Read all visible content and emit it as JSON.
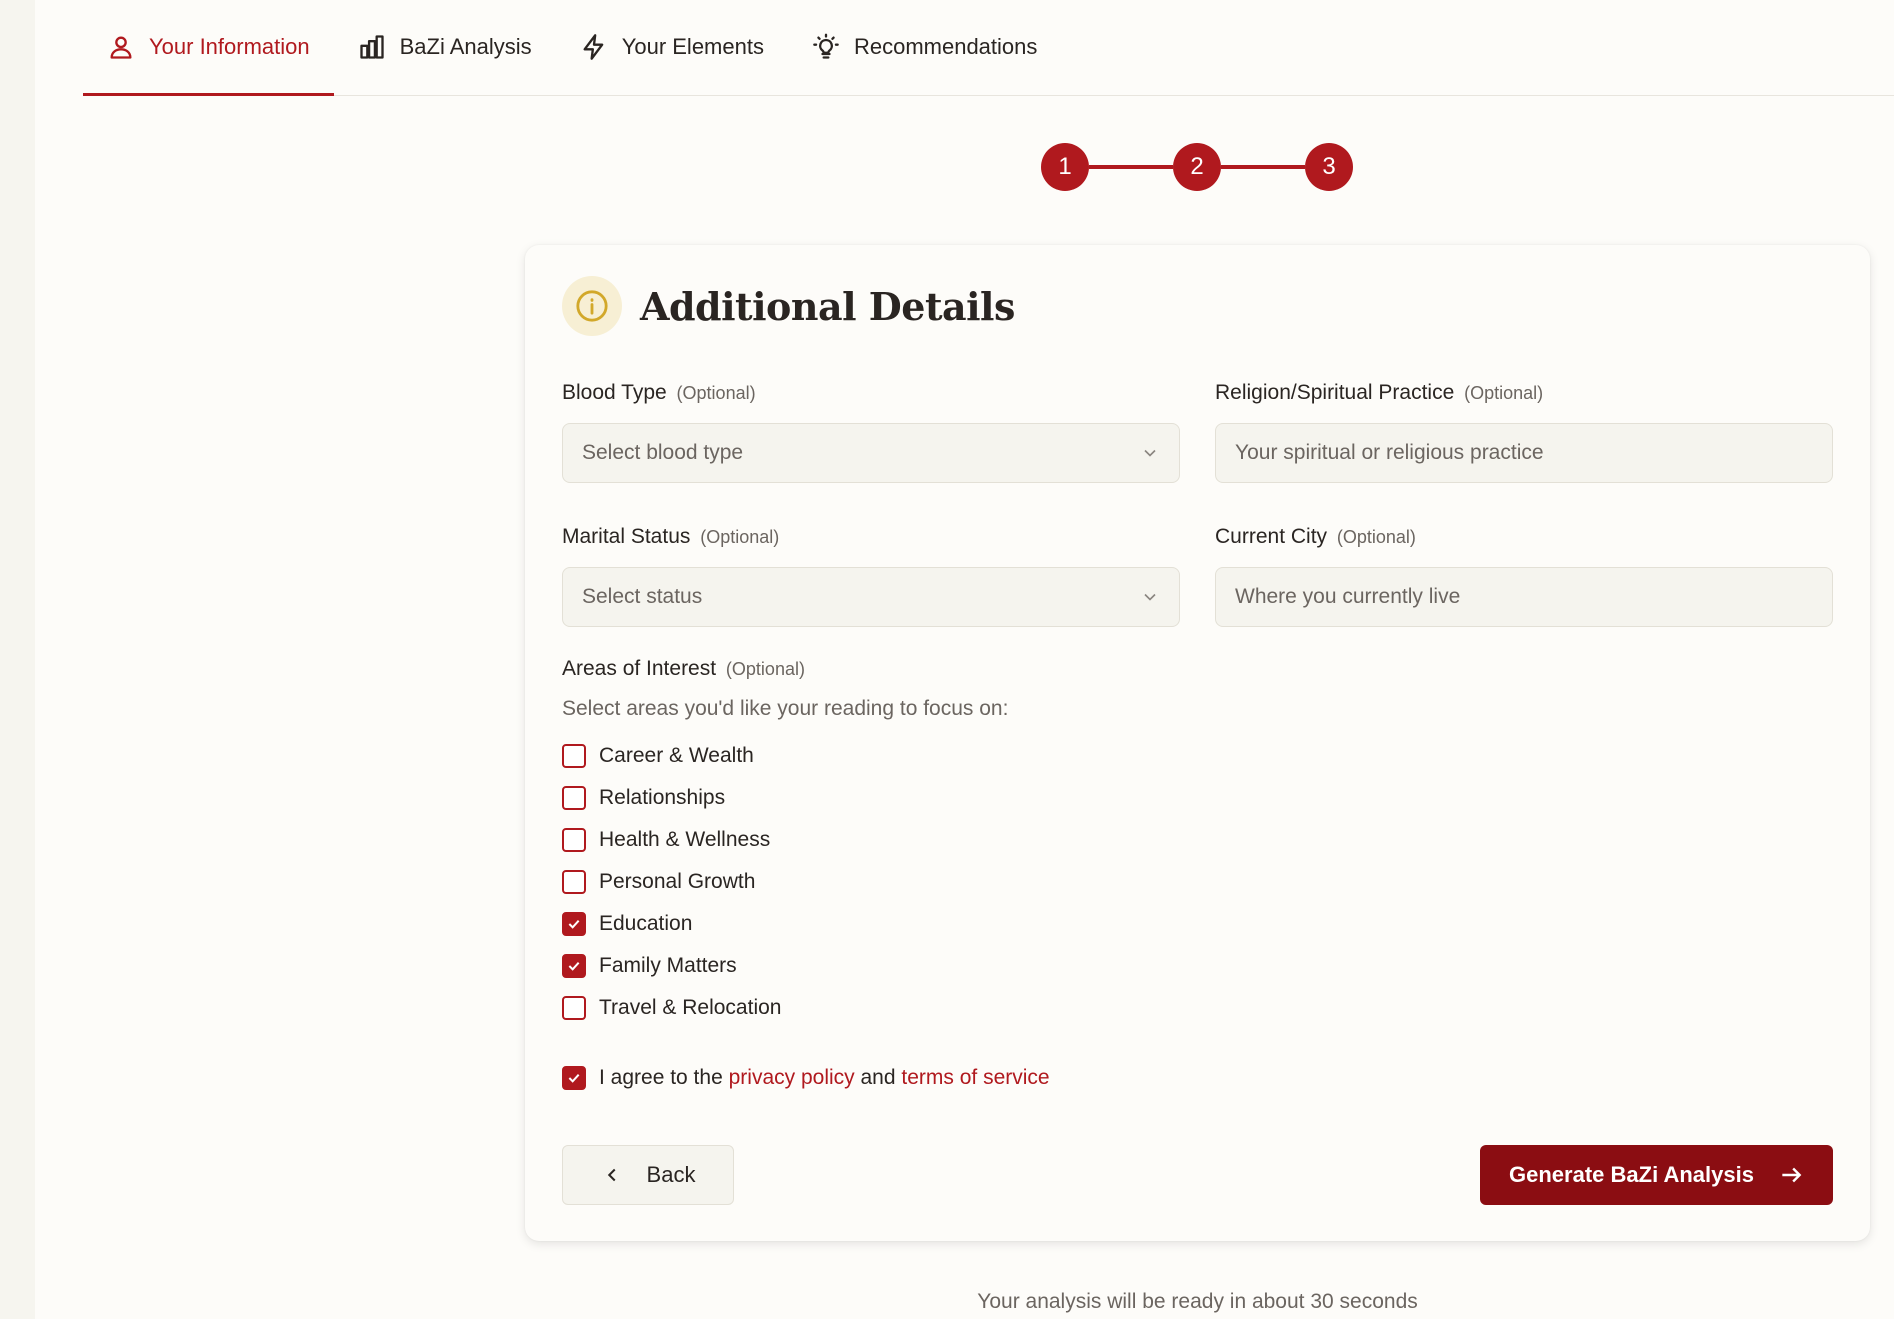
{
  "tabs": [
    {
      "label": "Your Information",
      "icon": "user-icon",
      "active": true
    },
    {
      "label": "BaZi Analysis",
      "icon": "bar-chart-icon",
      "active": false
    },
    {
      "label": "Your Elements",
      "icon": "lightning-icon",
      "active": false
    },
    {
      "label": "Recommendations",
      "icon": "lightbulb-icon",
      "active": false
    }
  ],
  "stepper": {
    "steps": [
      "1",
      "2",
      "3"
    ]
  },
  "card": {
    "title": "Additional Details",
    "fields": {
      "blood_type": {
        "label": "Blood Type",
        "optional": "(Optional)",
        "placeholder": "Select blood type"
      },
      "religion": {
        "label": "Religion/Spiritual Practice",
        "optional": "(Optional)",
        "placeholder": "Your spiritual or religious practice"
      },
      "marital": {
        "label": "Marital Status",
        "optional": "(Optional)",
        "placeholder": "Select status"
      },
      "city": {
        "label": "Current City",
        "optional": "(Optional)",
        "placeholder": "Where you currently live"
      }
    },
    "interests": {
      "label": "Areas of Interest",
      "optional": "(Optional)",
      "hint": "Select areas you'd like your reading to focus on:",
      "options": [
        {
          "label": "Career & Wealth",
          "checked": false
        },
        {
          "label": "Relationships",
          "checked": false
        },
        {
          "label": "Health & Wellness",
          "checked": false
        },
        {
          "label": "Personal Growth",
          "checked": false
        },
        {
          "label": "Education",
          "checked": true
        },
        {
          "label": "Family Matters",
          "checked": true
        },
        {
          "label": "Travel & Relocation",
          "checked": false
        }
      ]
    },
    "agree": {
      "prefix": "I agree to the",
      "privacy": "privacy policy",
      "middle": "and",
      "terms": "terms of service",
      "checked": true
    },
    "back_label": "Back",
    "generate_label": "Generate BaZi Analysis"
  },
  "footer_note": "Your analysis will be ready in about 30 seconds",
  "colors": {
    "accent": "#b0191e",
    "button": "#8b0d12",
    "info": "#d2a82a"
  }
}
